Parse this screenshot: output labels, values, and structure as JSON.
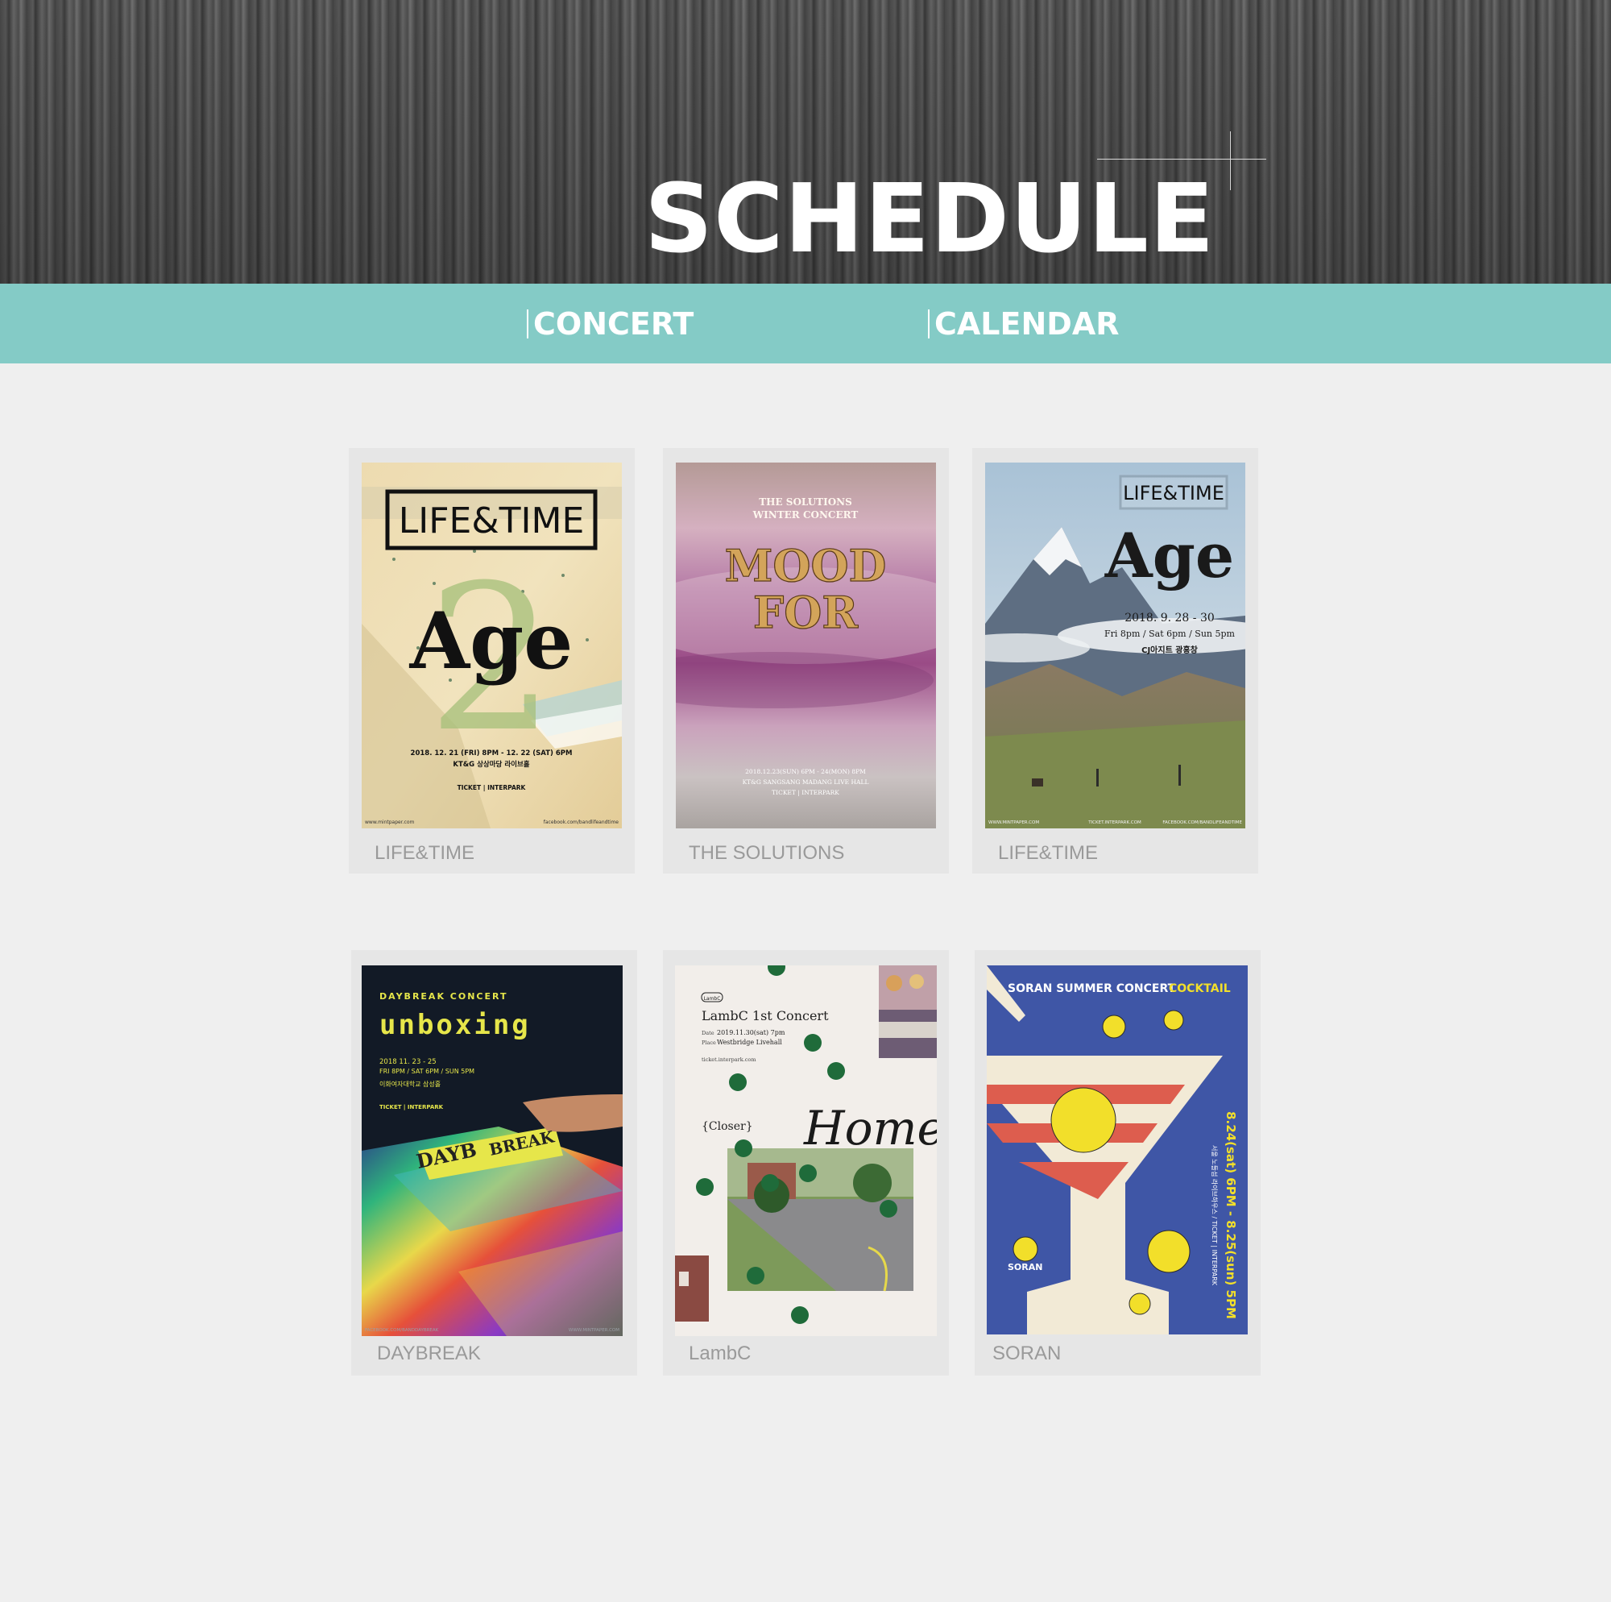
{
  "header": {
    "title": "SCHEDULE"
  },
  "nav": {
    "items": [
      {
        "label": "CONCERT"
      },
      {
        "label": "CALENDAR"
      }
    ]
  },
  "concerts": [
    {
      "label": "LIFE&TIME",
      "poster": {
        "logo": "LIFE&TIME",
        "headline": "Age",
        "numeral": "2",
        "date": "2018. 12. 21 (FRI) 8PM - 12. 22 (SAT) 6PM",
        "venue": "KT&G 상상마당 라이브홀",
        "ticket": "TICKET | INTERPARK",
        "footer_left": "www.mintpaper.com",
        "footer_right": "facebook.com/bandlifeandtime"
      }
    },
    {
      "label": "THE SOLUTIONS",
      "poster": {
        "subtitle_line1": "THE SOLUTIONS",
        "subtitle_line2": "WINTER CONCERT",
        "headline_line1": "MOOD",
        "headline_line2": "FOR",
        "date": "2018.12.23(SUN) 6PM - 24(MON) 8PM",
        "venue": "KT&G SANGSANG MADANG LIVE HALL",
        "ticket": "TICKET | INTERPARK"
      }
    },
    {
      "label": "LIFE&TIME",
      "poster": {
        "logo": "LIFE&TIME",
        "headline": "Age",
        "date": "2018. 9. 28 - 30",
        "times": "Fri 8pm / Sat 6pm / Sun 5pm",
        "venue": "CJ아지트 광흥창",
        "footer_left": "WWW.MINTPAPER.COM",
        "footer_mid": "TICKET.INTERPARK.COM",
        "footer_right": "FACEBOOK.COM/BANDLIFEANDTIME"
      }
    },
    {
      "label": "DAYBREAK",
      "poster": {
        "subtitle": "DAYBREAK CONCERT",
        "headline": "unboxing",
        "date": "2018 11. 23 - 25",
        "times": "FRI 8PM / SAT 6PM / SUN 5PM",
        "venue": "이화여자대학교 삼성홀",
        "ticket": "TICKET | INTERPARK",
        "box_text": "DAYB",
        "ticket_text": "BREAK",
        "footer_left": "FACEBOOK.COM/BANDDAYBREAK",
        "footer_right": "WWW.MINTPAPER.COM"
      }
    },
    {
      "label": "LambC",
      "poster": {
        "badge": "LambC",
        "headline": "LambC 1st Concert",
        "date_label": "Date",
        "date": "2019.11.30(sat) 7pm",
        "place_label": "Place",
        "place": "Westbridge Livehall",
        "url": "ticket.interpark.com",
        "closer": "{Closer}",
        "script": "Home"
      }
    },
    {
      "label": "SORAN",
      "poster": {
        "headline": "SORAN SUMMER CONCERT",
        "headline_accent": "COCKTAIL",
        "date": "8.24(sat) 6PM - 8.25(sun) 5PM",
        "venue": "서울 노들섬 라이브하우스 / TICKET | INTERPARK",
        "logo": "SORAN"
      }
    }
  ],
  "colors": {
    "nav_bg": "#84cbc6",
    "page_bg": "#efefef",
    "card_bg": "#e6e6e6",
    "label_text": "#9a9a9a"
  }
}
